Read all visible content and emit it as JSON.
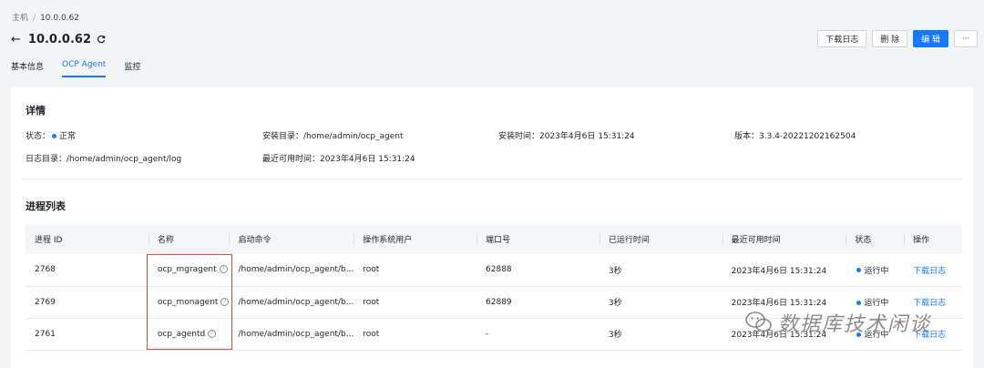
{
  "breadcrumb": {
    "root": "主机",
    "separator": "/",
    "current": "10.0.0.62"
  },
  "header": {
    "title": "10.0.0.62",
    "buttons": {
      "download_log": "下载日志",
      "delete": "删 除",
      "edit": "编 辑",
      "more": "···"
    }
  },
  "tabs": [
    {
      "label": "基本信息",
      "active": false
    },
    {
      "label": "OCP Agent",
      "active": true
    },
    {
      "label": "监控",
      "active": false
    }
  ],
  "details": {
    "title": "详情",
    "status_label": "状态：",
    "status_value": "正常",
    "install_dir": "安装目录：/home/admin/ocp_agent",
    "install_time": "安装时间：2023年4月6日 15:31:24",
    "version": "版本：3.3.4-20221202162504",
    "log_dir": "日志目录：/home/admin/ocp_agent/log",
    "last_available": "最近可用时间：2023年4月6日 15:31:24"
  },
  "process_list": {
    "title": "进程列表",
    "columns": [
      "进程 ID",
      "名称",
      "启动命令",
      "操作系统用户",
      "端口号",
      "已运行时间",
      "最近可用时间",
      "状态",
      "操作"
    ],
    "rows": [
      {
        "pid": "2768",
        "name": "ocp_mgragent",
        "command": "/home/admin/ocp_agent/b...",
        "user": "root",
        "port": "62888",
        "uptime": "3秒",
        "last_available": "2023年4月6日 15:31:24",
        "status": "运行中",
        "action": "下载日志"
      },
      {
        "pid": "2769",
        "name": "ocp_monagent",
        "command": "/home/admin/ocp_agent/b...",
        "user": "root",
        "port": "62889",
        "uptime": "3秒",
        "last_available": "2023年4月6日 15:31:24",
        "status": "运行中",
        "action": "下载日志"
      },
      {
        "pid": "2761",
        "name": "ocp_agentd",
        "command": "/home/admin/ocp_agent/b...",
        "user": "root",
        "port": "-",
        "uptime": "3秒",
        "last_available": "2023年4月6日 15:31:24",
        "status": "运行中",
        "action": "下载日志"
      }
    ]
  },
  "watermark": {
    "text": "数据库技术闲谈"
  },
  "colors": {
    "accent": "#1677ff",
    "highlight": "#e04a4a"
  }
}
